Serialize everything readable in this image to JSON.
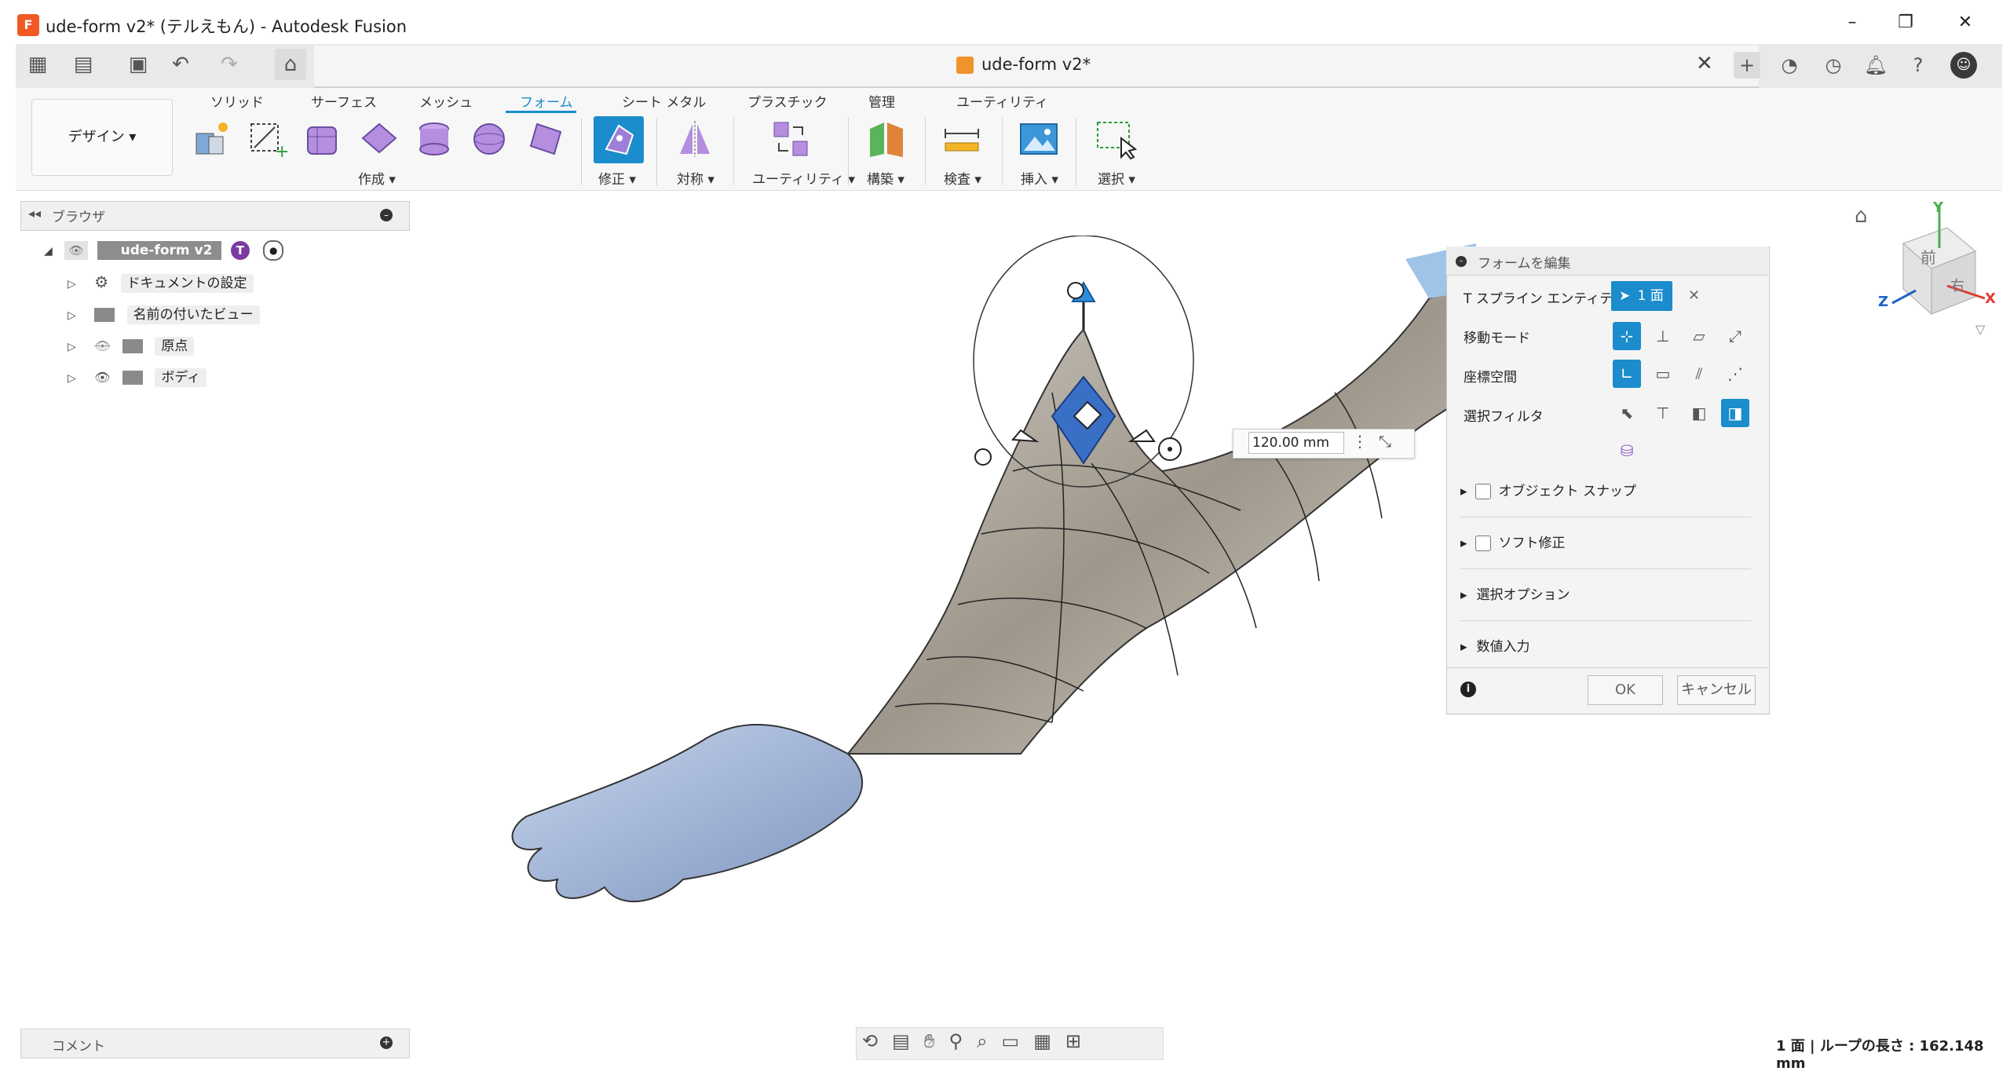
{
  "window": {
    "title": "ude-form v2* (テルえもん) - Autodesk Fusion",
    "logo_letter": "F"
  },
  "document_tab": {
    "label": "ude-form v2*"
  },
  "workspace": {
    "label": "デザイン ▾"
  },
  "ribbon": {
    "tabs": [
      "ソリッド",
      "サーフェス",
      "メッシュ",
      "フォーム",
      "シート メタル",
      "プラスチック",
      "管理",
      "ユーティリティ"
    ],
    "active_tab": "フォーム",
    "groups": [
      "作成 ▾",
      "修正 ▾",
      "対称 ▾",
      "ユーティリティ ▾",
      "構築 ▾",
      "検査 ▾",
      "挿入 ▾",
      "選択 ▾"
    ]
  },
  "browser": {
    "title": "ブラウザ",
    "root": "ude-form v2",
    "items": [
      "ドキュメントの設定",
      "名前の付いたビュー",
      "原点",
      "ボディ"
    ]
  },
  "comments": {
    "title": "コメント"
  },
  "status": {
    "text": "1 面 | ループの長さ : 162.148 mm"
  },
  "dimension": {
    "value": "120.00 mm"
  },
  "panel": {
    "title": "フォームを編集",
    "tspline_label": "T スプライン エンティティ",
    "selection_chip": "1 面",
    "move_mode_label": "移動モード",
    "coord_space_label": "座標空間",
    "select_filter_label": "選択フィルタ",
    "sections": [
      "オブジェクト スナップ",
      "ソフト修正",
      "選択オプション",
      "数値入力"
    ],
    "ok": "OK",
    "cancel": "キャンセル"
  },
  "viewcube": {
    "axis_x": "X",
    "axis_y": "Y",
    "axis_z": "Z",
    "face_top": "前",
    "face_right": "右"
  },
  "colors": {
    "accent": "#1b8ccc",
    "brand": "#f05a22",
    "mesh_body": "#a8b9d8",
    "form_body": "#a9a396"
  }
}
